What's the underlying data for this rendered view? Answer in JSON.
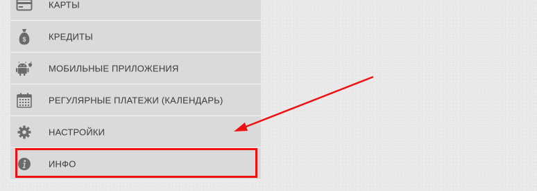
{
  "menu": {
    "items": [
      {
        "label": "КАРТЫ",
        "icon": "credit-card-icon"
      },
      {
        "label": "КРЕДИТЫ",
        "icon": "money-bag-icon"
      },
      {
        "label": "МОБИЛЬНЫЕ ПРИЛОЖЕНИЯ",
        "icon": "android-apple-icon"
      },
      {
        "label": "РЕГУЛЯРНЫЕ ПЛАТЕЖИ (КАЛЕНДАРЬ)",
        "icon": "calendar-icon"
      },
      {
        "label": "НАСТРОЙКИ",
        "icon": "gear-icon"
      },
      {
        "label": "ИНФО",
        "icon": "info-icon"
      }
    ]
  },
  "annotation": {
    "color": "#ee1111",
    "highlighted_item": "ИНФО"
  },
  "colors": {
    "menu_bg": "#dadada",
    "icon": "#6b6b6b",
    "text": "#3a3a3a"
  }
}
